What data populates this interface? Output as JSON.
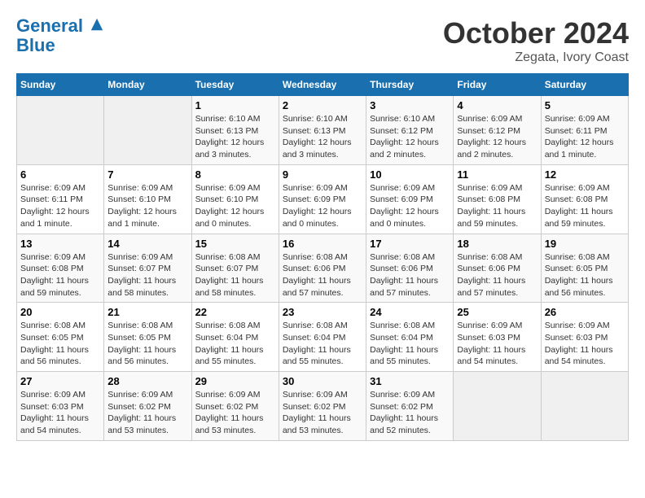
{
  "header": {
    "logo_line1": "General",
    "logo_line2": "Blue",
    "month": "October 2024",
    "location": "Zegata, Ivory Coast"
  },
  "weekdays": [
    "Sunday",
    "Monday",
    "Tuesday",
    "Wednesday",
    "Thursday",
    "Friday",
    "Saturday"
  ],
  "weeks": [
    [
      {
        "day": "",
        "info": ""
      },
      {
        "day": "",
        "info": ""
      },
      {
        "day": "1",
        "info": "Sunrise: 6:10 AM\nSunset: 6:13 PM\nDaylight: 12 hours and 3 minutes."
      },
      {
        "day": "2",
        "info": "Sunrise: 6:10 AM\nSunset: 6:13 PM\nDaylight: 12 hours and 3 minutes."
      },
      {
        "day": "3",
        "info": "Sunrise: 6:10 AM\nSunset: 6:12 PM\nDaylight: 12 hours and 2 minutes."
      },
      {
        "day": "4",
        "info": "Sunrise: 6:09 AM\nSunset: 6:12 PM\nDaylight: 12 hours and 2 minutes."
      },
      {
        "day": "5",
        "info": "Sunrise: 6:09 AM\nSunset: 6:11 PM\nDaylight: 12 hours and 1 minute."
      }
    ],
    [
      {
        "day": "6",
        "info": "Sunrise: 6:09 AM\nSunset: 6:11 PM\nDaylight: 12 hours and 1 minute."
      },
      {
        "day": "7",
        "info": "Sunrise: 6:09 AM\nSunset: 6:10 PM\nDaylight: 12 hours and 1 minute."
      },
      {
        "day": "8",
        "info": "Sunrise: 6:09 AM\nSunset: 6:10 PM\nDaylight: 12 hours and 0 minutes."
      },
      {
        "day": "9",
        "info": "Sunrise: 6:09 AM\nSunset: 6:09 PM\nDaylight: 12 hours and 0 minutes."
      },
      {
        "day": "10",
        "info": "Sunrise: 6:09 AM\nSunset: 6:09 PM\nDaylight: 12 hours and 0 minutes."
      },
      {
        "day": "11",
        "info": "Sunrise: 6:09 AM\nSunset: 6:08 PM\nDaylight: 11 hours and 59 minutes."
      },
      {
        "day": "12",
        "info": "Sunrise: 6:09 AM\nSunset: 6:08 PM\nDaylight: 11 hours and 59 minutes."
      }
    ],
    [
      {
        "day": "13",
        "info": "Sunrise: 6:09 AM\nSunset: 6:08 PM\nDaylight: 11 hours and 59 minutes."
      },
      {
        "day": "14",
        "info": "Sunrise: 6:09 AM\nSunset: 6:07 PM\nDaylight: 11 hours and 58 minutes."
      },
      {
        "day": "15",
        "info": "Sunrise: 6:08 AM\nSunset: 6:07 PM\nDaylight: 11 hours and 58 minutes."
      },
      {
        "day": "16",
        "info": "Sunrise: 6:08 AM\nSunset: 6:06 PM\nDaylight: 11 hours and 57 minutes."
      },
      {
        "day": "17",
        "info": "Sunrise: 6:08 AM\nSunset: 6:06 PM\nDaylight: 11 hours and 57 minutes."
      },
      {
        "day": "18",
        "info": "Sunrise: 6:08 AM\nSunset: 6:06 PM\nDaylight: 11 hours and 57 minutes."
      },
      {
        "day": "19",
        "info": "Sunrise: 6:08 AM\nSunset: 6:05 PM\nDaylight: 11 hours and 56 minutes."
      }
    ],
    [
      {
        "day": "20",
        "info": "Sunrise: 6:08 AM\nSunset: 6:05 PM\nDaylight: 11 hours and 56 minutes."
      },
      {
        "day": "21",
        "info": "Sunrise: 6:08 AM\nSunset: 6:05 PM\nDaylight: 11 hours and 56 minutes."
      },
      {
        "day": "22",
        "info": "Sunrise: 6:08 AM\nSunset: 6:04 PM\nDaylight: 11 hours and 55 minutes."
      },
      {
        "day": "23",
        "info": "Sunrise: 6:08 AM\nSunset: 6:04 PM\nDaylight: 11 hours and 55 minutes."
      },
      {
        "day": "24",
        "info": "Sunrise: 6:08 AM\nSunset: 6:04 PM\nDaylight: 11 hours and 55 minutes."
      },
      {
        "day": "25",
        "info": "Sunrise: 6:09 AM\nSunset: 6:03 PM\nDaylight: 11 hours and 54 minutes."
      },
      {
        "day": "26",
        "info": "Sunrise: 6:09 AM\nSunset: 6:03 PM\nDaylight: 11 hours and 54 minutes."
      }
    ],
    [
      {
        "day": "27",
        "info": "Sunrise: 6:09 AM\nSunset: 6:03 PM\nDaylight: 11 hours and 54 minutes."
      },
      {
        "day": "28",
        "info": "Sunrise: 6:09 AM\nSunset: 6:02 PM\nDaylight: 11 hours and 53 minutes."
      },
      {
        "day": "29",
        "info": "Sunrise: 6:09 AM\nSunset: 6:02 PM\nDaylight: 11 hours and 53 minutes."
      },
      {
        "day": "30",
        "info": "Sunrise: 6:09 AM\nSunset: 6:02 PM\nDaylight: 11 hours and 53 minutes."
      },
      {
        "day": "31",
        "info": "Sunrise: 6:09 AM\nSunset: 6:02 PM\nDaylight: 11 hours and 52 minutes."
      },
      {
        "day": "",
        "info": ""
      },
      {
        "day": "",
        "info": ""
      }
    ]
  ]
}
